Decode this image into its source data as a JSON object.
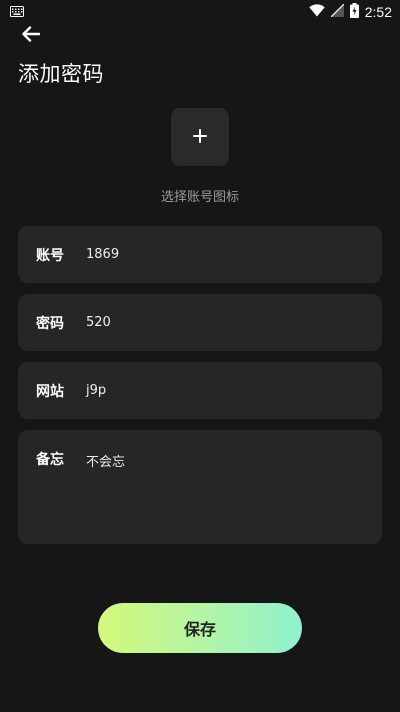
{
  "status_bar": {
    "time": "2:52",
    "icons": [
      "keyboard-icon",
      "wifi-icon",
      "signal-icon",
      "battery-icon"
    ]
  },
  "header": {
    "back_icon": "back-arrow-icon",
    "title": "添加密码"
  },
  "icon_picker": {
    "icon": "plus-icon",
    "label": "选择账号图标"
  },
  "form": {
    "account": {
      "label": "账号",
      "value": "1869"
    },
    "password": {
      "label": "密码",
      "value": "520"
    },
    "website": {
      "label": "网站",
      "value": "j9p"
    },
    "note": {
      "label": "备忘",
      "value": "不会忘"
    }
  },
  "save_button": {
    "label": "保存"
  },
  "colors": {
    "background": "#161616",
    "card": "#262626",
    "button_gradient_start": "#d4f87a",
    "button_gradient_end": "#8ef1cf"
  }
}
